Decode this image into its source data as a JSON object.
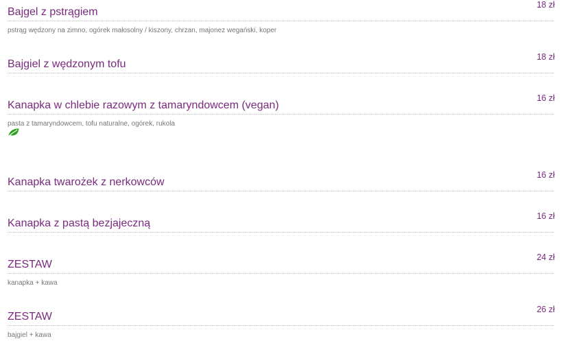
{
  "menu": {
    "items": [
      {
        "name": "Bajgel z pstrągiem",
        "price": "18 zł",
        "description": "pstrąg wędzony na zimno, ogórek małosolny / kiszony, chrzan, majonez wegański, koper"
      },
      {
        "name": "Bajgiel z wędzonym tofu",
        "price": "18 zł"
      },
      {
        "name": "Kanapka w chlebie razowym z tamaryndowcem (vegan)",
        "price": "16 zł",
        "description": "pasta z tamaryndowcem, tofu naturalne, ogórek, rukola",
        "badge_icon": "leaf-icon"
      },
      {
        "name": "Kanapka twarożek z nerkowców",
        "price": "16 zł"
      },
      {
        "name": "Kanapka z pastą bezjajeczną",
        "price": "16 zł"
      },
      {
        "name": "ZESTAW",
        "price": "24 zł",
        "description": "kanapka + kawa"
      },
      {
        "name": "ZESTAW",
        "price": "26 zł",
        "description": "bajgiel + kawa"
      }
    ]
  },
  "colors": {
    "item_name": "#7a2a7e",
    "price": "#7a2a7e",
    "description": "#777777",
    "leader": "#bdbdbd",
    "vegan_badge": "#2e9e1f"
  }
}
